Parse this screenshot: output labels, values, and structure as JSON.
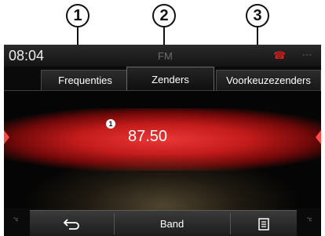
{
  "callouts": [
    "1",
    "2",
    "3"
  ],
  "status": {
    "time": "08:04",
    "source": "FM",
    "phone_icon": "phone-icon",
    "signal_icon": "signal-icon",
    "signal_text": "---"
  },
  "tabs": [
    {
      "label": "Frequenties",
      "active": false
    },
    {
      "label": "Zenders",
      "active": true
    },
    {
      "label": "Voorkeuzezenders",
      "active": false
    }
  ],
  "tuner": {
    "marker": "1",
    "frequency": "87.50",
    "left_unit": "°c",
    "right_unit": "°c"
  },
  "bottom_bar": {
    "back_icon": "back-arrow-icon",
    "band_label": "Band",
    "menu_icon": "list-menu-icon"
  },
  "colors": {
    "accent_red": "#d11d1d",
    "glow_red": "#e83737",
    "text": "#ffffff",
    "screen_bg": "#0a0a0a"
  }
}
